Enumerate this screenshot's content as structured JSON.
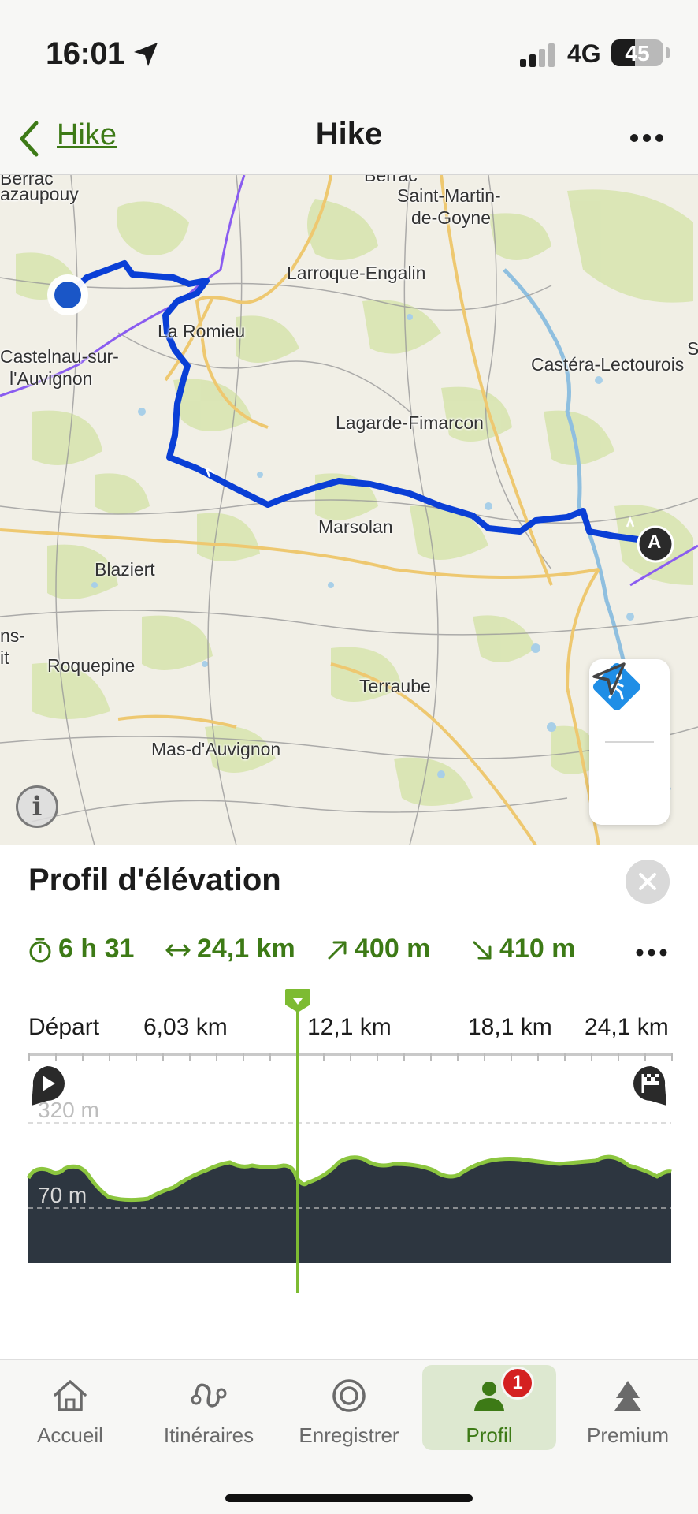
{
  "status_bar": {
    "time": "16:01",
    "network": "4G",
    "battery": "45",
    "battery_level": 0.45
  },
  "nav": {
    "back_label": "Hike",
    "title": "Hike"
  },
  "map": {
    "labels": [
      {
        "id": "lbl-cazaupouy",
        "text": "azaupouy"
      },
      {
        "id": "lbl-berrac",
        "text": "Berrac"
      },
      {
        "id": "lbl-saint-martin",
        "text": "Saint-Martin-"
      },
      {
        "id": "lbl-de-goyne",
        "text": "de-Goyne"
      },
      {
        "id": "lbl-larroque",
        "text": "Larroque-Engalin"
      },
      {
        "id": "lbl-la-romieu",
        "text": "La Romieu"
      },
      {
        "id": "lbl-castelnau-1",
        "text": "Castelnau-sur-"
      },
      {
        "id": "lbl-castelnau-2",
        "text": "l'Auvignon"
      },
      {
        "id": "lbl-castera",
        "text": "Castéra-Lectourois"
      },
      {
        "id": "lbl-lagarde",
        "text": "Lagarde-Fimarcon"
      },
      {
        "id": "lbl-marsolan",
        "text": "Marsolan"
      },
      {
        "id": "lbl-blaziert",
        "text": "Blaziert"
      },
      {
        "id": "lbl-ns",
        "text": "ns-"
      },
      {
        "id": "lbl-it",
        "text": "it"
      },
      {
        "id": "lbl-roquepine",
        "text": "Roquepine"
      },
      {
        "id": "lbl-terraube",
        "text": "Terraube"
      },
      {
        "id": "lbl-mas",
        "text": "Mas-d'Auvignon"
      },
      {
        "id": "lbl-s",
        "text": "S"
      }
    ],
    "marker_label": "A",
    "info_glyph": "i"
  },
  "elevation": {
    "title": "Profil d'élévation",
    "stats": {
      "duration": "6 h 31",
      "distance": "24,1 km",
      "ascent": "400 m",
      "descent": "410 m"
    },
    "distance_axis": [
      "Départ",
      "6,03 km",
      "12,1 km",
      "18,1 km",
      "24,1 km"
    ],
    "elevation_axis": [
      "320 m",
      "70 m"
    ]
  },
  "tabs": [
    {
      "label": "Accueil",
      "icon": "home-icon"
    },
    {
      "label": "Itinéraires",
      "icon": "route-icon"
    },
    {
      "label": "Enregistrer",
      "icon": "record-icon"
    },
    {
      "label": "Profil",
      "icon": "profile-icon",
      "badge": "1",
      "active": true
    },
    {
      "label": "Premium",
      "icon": "premium-icon"
    }
  ],
  "colors": {
    "accent_green": "#3d7a16",
    "route_blue": "#0a3fd6",
    "elevation_fill": "#2d3640",
    "elevation_line": "#8cc63f",
    "badge_red": "#d42020"
  }
}
